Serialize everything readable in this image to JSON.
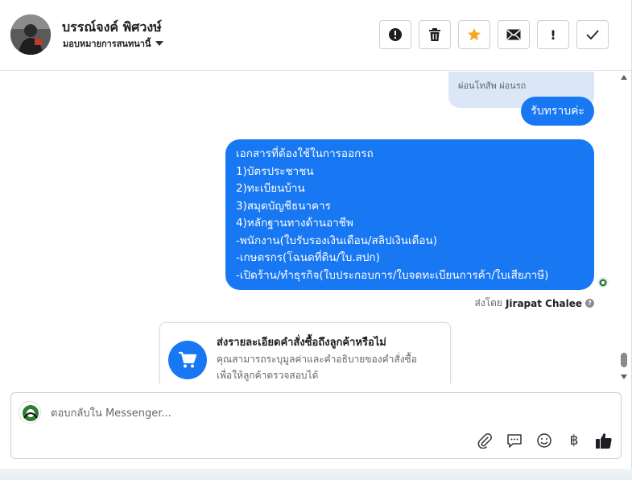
{
  "header": {
    "contact_name": "บรรณ์จงค์ พิศวงษ์",
    "assign_label": "มอบหมายการสนทนานี้",
    "action_icons": [
      "alert-circle-icon",
      "trash-icon",
      "star-icon",
      "envelope-icon",
      "exclamation-icon",
      "checkmark-icon"
    ],
    "star_color": "#f5a623",
    "exclamation_label": "!"
  },
  "messages": {
    "quoted_text": "ผ่อนโทสัพ ผ่อนรถ",
    "reply_short": "รับทราบค่ะ",
    "reply_long": "เอกสารที่ต้องใช้ในการออกรถ\n1)บัตรประชาชน\n2)ทะเบียนบ้าน\n3)สมุดบัญชีธนาคาร\n4)หลักฐานทางด้านอาชีพ\n-พนักงาน(ใบรับรองเงินเดือน/สลิปเงินเดือน)\n-เกษตรกร(โฉนดที่ดิน/ใบ.สปก)\n-เปิดร้าน/ทำธุรกิจ(ใบประกอบการ/ใบจดทะเบียนการค้า/ใบเสียภาษี)",
    "sent_by_prefix": "ส่งโดย",
    "sent_by_name": "Jirapat Chalee",
    "help_glyph": "?",
    "bubble_color": "#1877f2"
  },
  "order_card": {
    "title": "ส่งรายละเอียดคำสั่งซื้อถึงลูกค้าหรือไม่",
    "description": "คุณสามารถระบุมูลค่าและคำอธิบายของคำสั่งซื้อ\nเพื่อให้ลูกค้าตรวจสอบได้",
    "icon": "shopping-cart-icon"
  },
  "composer": {
    "placeholder": "ตอบกลับใน Messenger...",
    "tools": [
      "paperclip-icon",
      "chat-bubble-icon",
      "smiley-icon",
      "baht-icon",
      "thumbs-up-icon"
    ],
    "baht_glyph": "฿"
  }
}
